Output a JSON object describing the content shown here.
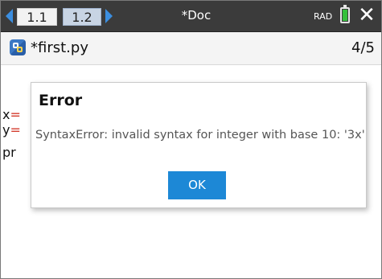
{
  "topbar": {
    "tabs": [
      {
        "label": "1.1",
        "active": true
      },
      {
        "label": "1.2",
        "active": false
      }
    ],
    "doc_title": "*Doc",
    "angle_mode": "RAD",
    "icons": {
      "prev": "chevron-left-icon",
      "next": "chevron-right-icon",
      "battery": "battery-icon",
      "close": "close-icon"
    },
    "close_glyph": "✕"
  },
  "filebar": {
    "filename": "*first.py",
    "page": "4/5",
    "icon": "python-file-icon"
  },
  "editor": {
    "lines": [
      {
        "prefix": "x",
        "op": "="
      },
      {
        "prefix": "y",
        "op": "="
      },
      {
        "prefix": "pr",
        "op": ""
      }
    ]
  },
  "dialog": {
    "title": "Error",
    "message": "SyntaxError: invalid syntax for integer with base 10: '3x'",
    "ok_label": "OK"
  },
  "colors": {
    "topbar_bg": "#3b3b3b",
    "accent": "#1d88d6",
    "arrow": "#3b8ee0",
    "battery": "#35c03b",
    "operator": "#d33a2c"
  }
}
